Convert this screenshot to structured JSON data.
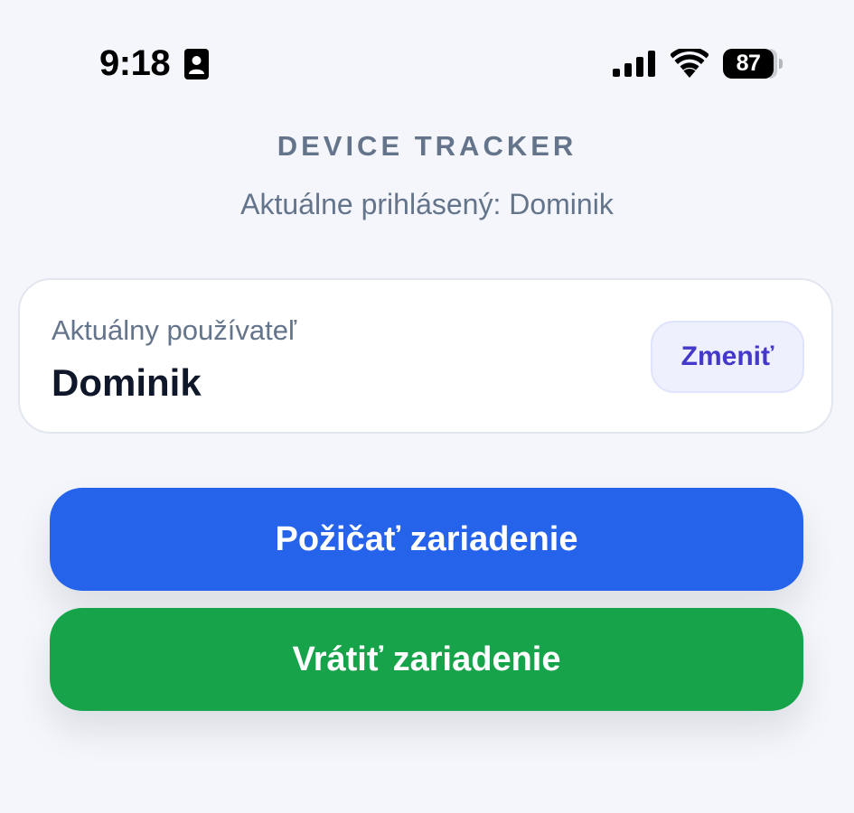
{
  "status_bar": {
    "time": "9:18",
    "battery_level": "87",
    "icons": [
      "contact-card-icon",
      "cellular-signal-icon",
      "wifi-icon",
      "battery-icon"
    ]
  },
  "header": {
    "title": "DEVICE TRACKER",
    "logged_in_text": "Aktuálne prihlásený: Dominik"
  },
  "user_card": {
    "label": "Aktuálny používateľ",
    "name": "Dominik",
    "change_label": "Zmeniť"
  },
  "actions": {
    "borrow_label": "Požičať zariadenie",
    "return_label": "Vrátiť zariadenie"
  },
  "colors": {
    "background": "#f4f6fb",
    "borrow_button": "#2563eb",
    "return_button": "#16a34a",
    "change_button_text": "#4338ca",
    "muted_text": "#64748b"
  }
}
